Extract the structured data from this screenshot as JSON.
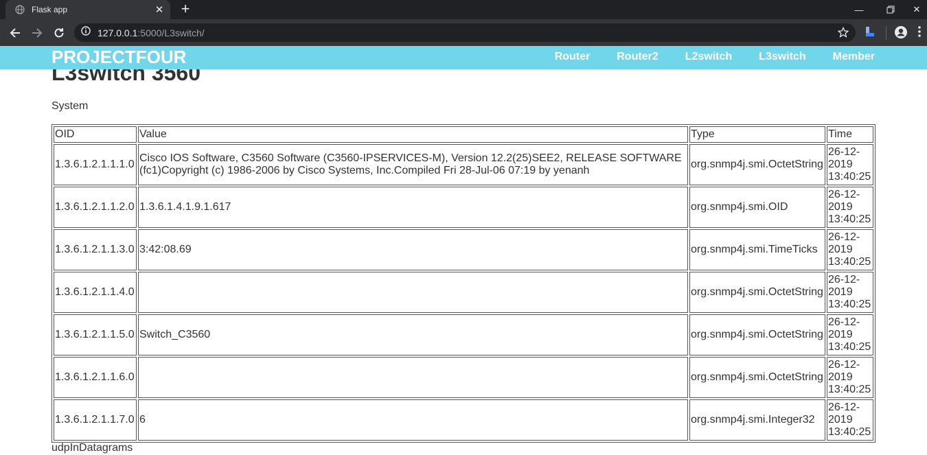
{
  "browser": {
    "tab_title": "Flask app",
    "url_host": "127.0.0.1",
    "url_rest": ":5000/L3switch/"
  },
  "navbar": {
    "brand": "PROJECTFOUR",
    "links": [
      "Router",
      "Router2",
      "L2switch",
      "L3switch",
      "Member"
    ]
  },
  "page": {
    "title": "L3switch 3560",
    "section1": "System",
    "section2": "udpInDatagrams"
  },
  "table": {
    "headers": [
      "OID",
      "Value",
      "Type",
      "Time"
    ],
    "rows": [
      {
        "oid": "1.3.6.1.2.1.1.1.0",
        "value": "Cisco IOS Software, C3560 Software (C3560-IPSERVICES-M), Version 12.2(25)SEE2, RELEASE SOFTWARE (fc1)Copyright (c) 1986-2006 by Cisco Systems, Inc.Compiled Fri 28-Jul-06 07:19 by yenanh",
        "type": "org.snmp4j.smi.OctetString",
        "time": "26-12-2019 13:40:25"
      },
      {
        "oid": "1.3.6.1.2.1.1.2.0",
        "value": "1.3.6.1.4.1.9.1.617",
        "type": "org.snmp4j.smi.OID",
        "time": "26-12-2019 13:40:25"
      },
      {
        "oid": "1.3.6.1.2.1.1.3.0",
        "value": "3:42:08.69",
        "type": "org.snmp4j.smi.TimeTicks",
        "time": "26-12-2019 13:40:25"
      },
      {
        "oid": "1.3.6.1.2.1.1.4.0",
        "value": "",
        "type": "org.snmp4j.smi.OctetString",
        "time": "26-12-2019 13:40:25"
      },
      {
        "oid": "1.3.6.1.2.1.1.5.0",
        "value": "Switch_C3560",
        "type": "org.snmp4j.smi.OctetString",
        "time": "26-12-2019 13:40:25"
      },
      {
        "oid": "1.3.6.1.2.1.1.6.0",
        "value": "",
        "type": "org.snmp4j.smi.OctetString",
        "time": "26-12-2019 13:40:25"
      },
      {
        "oid": "1.3.6.1.2.1.1.7.0",
        "value": "6",
        "type": "org.snmp4j.smi.Integer32",
        "time": "26-12-2019 13:40:25"
      }
    ]
  }
}
